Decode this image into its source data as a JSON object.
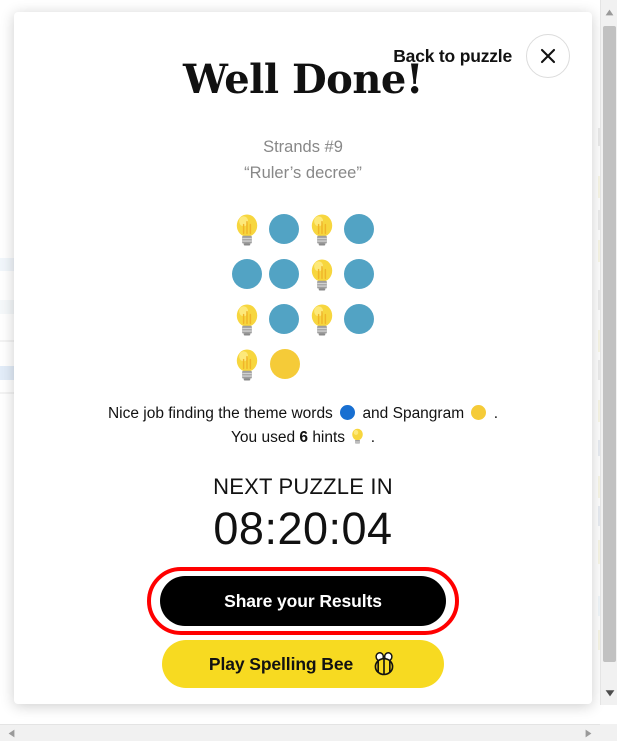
{
  "header": {
    "back_label": "Back to puzzle",
    "close_icon": "close-icon"
  },
  "title": "Well Done!",
  "subtitle": {
    "puzzle_name": "Strands #9",
    "theme": "“Ruler’s decree”"
  },
  "result_grid": {
    "rows": [
      [
        "bulb",
        "blue",
        "bulb",
        "blue"
      ],
      [
        "blue",
        "blue",
        "bulb",
        "blue"
      ],
      [
        "bulb",
        "blue",
        "bulb",
        "blue"
      ],
      [
        "bulb",
        "yellow"
      ]
    ],
    "colors": {
      "blue": "#52a3c4",
      "yellow": "#f5cb38"
    }
  },
  "description": {
    "part1": "Nice job finding the theme words",
    "part2": "and Spangram",
    "part3": ". You used",
    "hint_count": "6",
    "part4": "hints",
    "part5": "."
  },
  "countdown": {
    "label": "NEXT PUZZLE IN",
    "time": "08:20:04"
  },
  "buttons": {
    "share_label": "Share your Results",
    "spelling_bee_label": "Play Spelling Bee",
    "spelling_bee_icon": "bee-icon",
    "highlight_color": "#ff0000"
  },
  "scrollbars": {
    "up_arrow": "▲",
    "down_arrow": "▼",
    "left_arrow": "◀",
    "right_arrow": "▶"
  }
}
